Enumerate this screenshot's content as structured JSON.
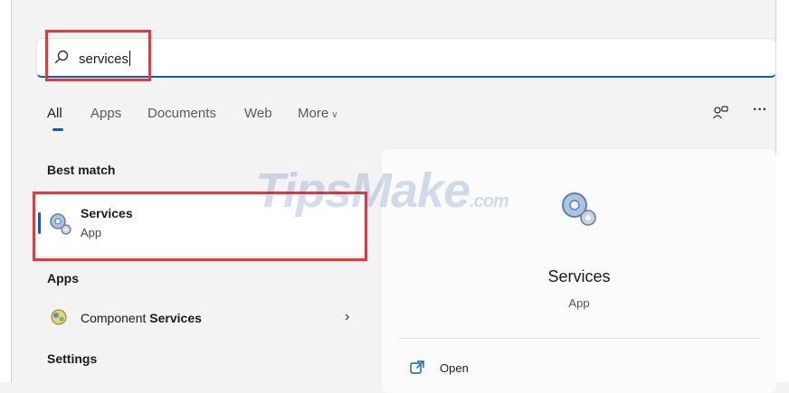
{
  "search": {
    "value": "services"
  },
  "tabs": [
    {
      "label": "All"
    },
    {
      "label": "Apps"
    },
    {
      "label": "Documents"
    },
    {
      "label": "Web"
    },
    {
      "label": "More"
    }
  ],
  "top_actions": {
    "more_label": "···"
  },
  "best_match": {
    "heading": "Best match",
    "title": "Services",
    "subtitle": "App",
    "icon": "gears-icon"
  },
  "apps": {
    "heading": "Apps",
    "items": [
      {
        "label_prefix": "Component ",
        "label_bold": "Services",
        "icon": "component-services-icon"
      }
    ]
  },
  "settings": {
    "heading": "Settings"
  },
  "details": {
    "title": "Services",
    "subtitle": "App",
    "actions": [
      {
        "label": "Open",
        "icon": "open-external-icon"
      }
    ]
  },
  "watermark": {
    "text": "TipsMake",
    "suffix": ".com"
  },
  "colors": {
    "accent": "#0a5fb4",
    "highlight": "#e8383d"
  }
}
